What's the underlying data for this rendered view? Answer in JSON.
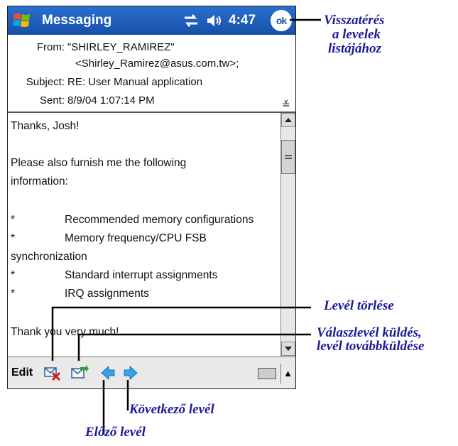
{
  "titlebar": {
    "app_title": "Messaging",
    "clock": "4:47",
    "ok_label": "ok",
    "icons": [
      "windows-start-icon",
      "connectivity-icon",
      "volume-icon"
    ]
  },
  "header": {
    "from_label": "From:",
    "from_name": "\"SHIRLEY_RAMIREZ\"",
    "from_email": "<Shirley_Ramirez@asus.com.tw>;",
    "subject_label": "Subject:",
    "subject_value": "RE: User Manual application",
    "sent_label": "Sent:",
    "sent_value": "8/9/04 1:07:14 PM",
    "expand_glyph": "≚"
  },
  "body": {
    "lines": [
      "Thanks, Josh!",
      "Please also furnish me the following",
      "information:",
      "*",
      "Recommended memory configurations",
      "*",
      "Memory frequency/CPU FSB",
      "synchronization",
      "*",
      "Standard interrupt assignments",
      "*",
      "IRQ assignments",
      "Thank you very much!"
    ]
  },
  "menubar": {
    "edit_label": "Edit",
    "kbd_arrow": "▲",
    "icons": [
      "delete-message-icon",
      "reply-forward-icon",
      "previous-message-icon",
      "next-message-icon",
      "keyboard-icon"
    ]
  },
  "annotations": {
    "return": [
      "Visszatérés",
      "a levelek",
      "listájához"
    ],
    "delete": "Levél törlése",
    "reply": [
      "Válaszlevél küldés,",
      "levél továbbküldése"
    ],
    "next": "Következő levél",
    "prev": "Előző levél"
  },
  "colors": {
    "titlebar": "#1750a8",
    "annotation": "#1a1a9a",
    "arrow_icon": "#3aa0e8",
    "delete_x": "#d42020"
  }
}
